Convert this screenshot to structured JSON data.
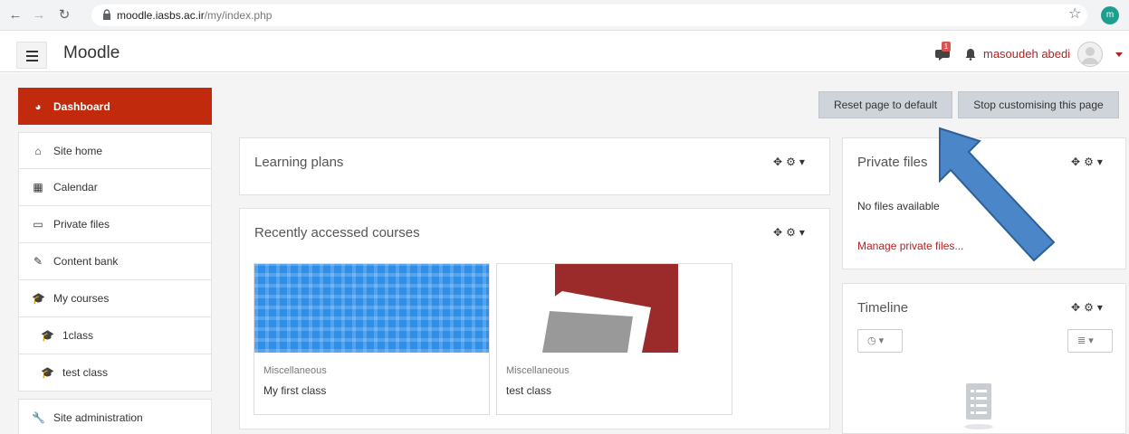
{
  "browser": {
    "url_domain": "moodle.iasbs.ac.ir",
    "url_path": "/my/index.php",
    "profile_initial": "m"
  },
  "navbar": {
    "site_name": "Moodle",
    "message_count": "1",
    "user_name": "masoudeh abedi"
  },
  "sidebar": {
    "items": [
      {
        "label": "Dashboard",
        "icon": "dashboard-icon"
      },
      {
        "label": "Site home",
        "icon": "home-icon"
      },
      {
        "label": "Calendar",
        "icon": "calendar-icon"
      },
      {
        "label": "Private files",
        "icon": "file-icon"
      },
      {
        "label": "Content bank",
        "icon": "brush-icon"
      },
      {
        "label": "My courses",
        "icon": "graduation-cap-icon"
      },
      {
        "label": "1class",
        "icon": "graduation-cap-icon"
      },
      {
        "label": "test class",
        "icon": "graduation-cap-icon"
      },
      {
        "label": "Site administration",
        "icon": "wrench-icon"
      }
    ]
  },
  "page_actions": {
    "reset_label": "Reset page to default",
    "stop_label": "Stop customising this page"
  },
  "blocks": {
    "learning_plans": {
      "title": "Learning plans"
    },
    "recent_courses": {
      "title": "Recently accessed courses",
      "courses": [
        {
          "category": "Miscellaneous",
          "name": "My first class"
        },
        {
          "category": "Miscellaneous",
          "name": "test class"
        }
      ]
    },
    "private_files": {
      "title": "Private files",
      "empty_text": "No files available",
      "manage_link": "Manage private files..."
    },
    "timeline": {
      "title": "Timeline"
    }
  },
  "colors": {
    "brand_red": "#c12a0d",
    "link_red": "#b22222",
    "annotation_arrow": "#4a86c8"
  }
}
